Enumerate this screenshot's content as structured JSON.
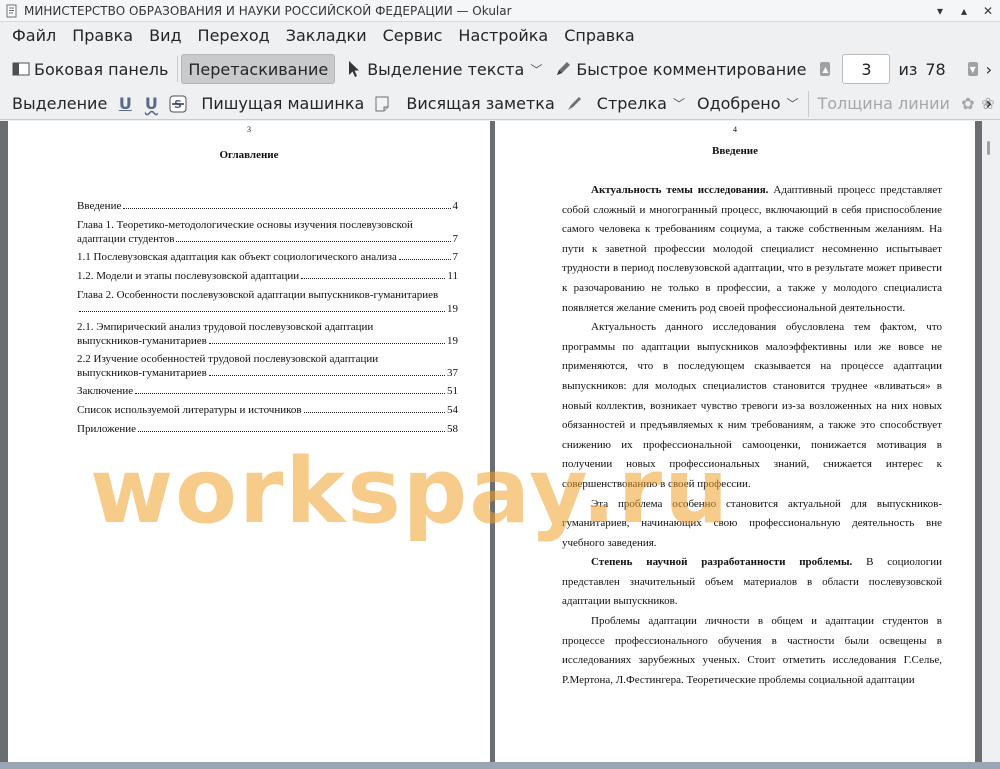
{
  "window": {
    "title": "МИНИСТЕРСТВО ОБРАЗОВАНИЯ И НАУКИ РОССИЙСКОЙ ФЕДЕРАЦИИ  — Okular"
  },
  "menu": [
    "Файл",
    "Правка",
    "Вид",
    "Переход",
    "Закладки",
    "Сервис",
    "Настройка",
    "Справка"
  ],
  "toolbar1": {
    "sidebar": "Боковая панель",
    "drag": "Перетаскивание",
    "text_select": "Выделение текста",
    "quick_comment": "Быстрое комментирование",
    "current_page": "3",
    "of_label": "из",
    "total_pages": "78"
  },
  "toolbar2": {
    "highlight": "Выделение",
    "typewriter": "Пишущая машинка",
    "note": "Висящая заметка",
    "arrow": "Стрелка",
    "stamp": "Одобрено",
    "line_width": "Толщина линии"
  },
  "left_page": {
    "number": "3",
    "title": "Оглавление",
    "toc": [
      {
        "text": "Введение",
        "page": "4"
      },
      {
        "text1": "Глава 1. Теоретико-методологические основы изучения послевузовской",
        "text": "адаптации студентов",
        "page": "7"
      },
      {
        "text": "1.1 Послевузовская адаптация как объект социологического анализа",
        "page": "7"
      },
      {
        "text": "1.2. Модели и этапы послевузовской адаптации",
        "page": "11"
      },
      {
        "text1": "Глава 2. Особенности послевузовской адаптации выпускников-гуманитариев",
        "text": "",
        "page": "19"
      },
      {
        "text1": "2.1.   Эмпирический   анализ    трудовой   послевузовской   адаптации",
        "text": "выпускников-гуманитариев",
        "page": "19"
      },
      {
        "text1": "2.2 Изучение особенностей трудовой послевузовской адаптации",
        "text": "выпускников-гуманитариев",
        "page": "37"
      },
      {
        "text": "Заключение",
        "page": "51"
      },
      {
        "text": "Список используемой литературы и источников",
        "page": "54"
      },
      {
        "text": "Приложение ",
        "page": "58"
      }
    ]
  },
  "right_page": {
    "number": "4",
    "title": "Введение",
    "paragraphs": [
      {
        "bold": "Актуальность темы исследования.",
        "text": " Адаптивный процесс представляет собой сложный и многогранный процесс, включающий в себя приспособление самого человека к требованиям социума, а также собственным желаниям. На пути к заветной профессии молодой специалист несомненно испытывает трудности в период послевузовской адаптации, что в результате может привести к разочарованию не только в профессии, а также у молодого специалиста появляется желание сменить род своей профессиональной деятельности."
      },
      {
        "bold": "",
        "text": "Актуальность данного исследования обусловлена тем фактом, что программы по адаптации выпускников малоэффективны или же вовсе не применяются, что в последующем сказывается на процессе адаптации выпускников: для молодых специалистов становится труднее «вливаться» в новый коллектив, возникает чувство тревоги из-за возложенных на них новых обязанностей и предъявляемых к ним требованиям, а также это способствует снижению их профессиональной самооценки, понижается мотивация в получении новых профессиональных знаний, снижается интерес к совершенствованию в своей профессии."
      },
      {
        "bold": "",
        "text": "Эта проблема особенно становится актуальной для выпускников-гуманитариев, начинающих свою профессиональную деятельность вне учебного заведения."
      },
      {
        "bold": "Степень научной разработанности проблемы.",
        "text": " В социологии представлен значительный объем материалов в области послевузовской адаптации выпускников."
      },
      {
        "bold": "",
        "text": "Проблемы адаптации личности в общем и адаптации студентов в процессе профессионального обучения в частности были освещены в исследованиях зарубежных ученых. Стоит отметить исследования Г.Селье, Р.Мертона, Л.Фестингера. Теоретические проблемы социальной адаптации"
      }
    ]
  },
  "watermark": "workspay.ru"
}
